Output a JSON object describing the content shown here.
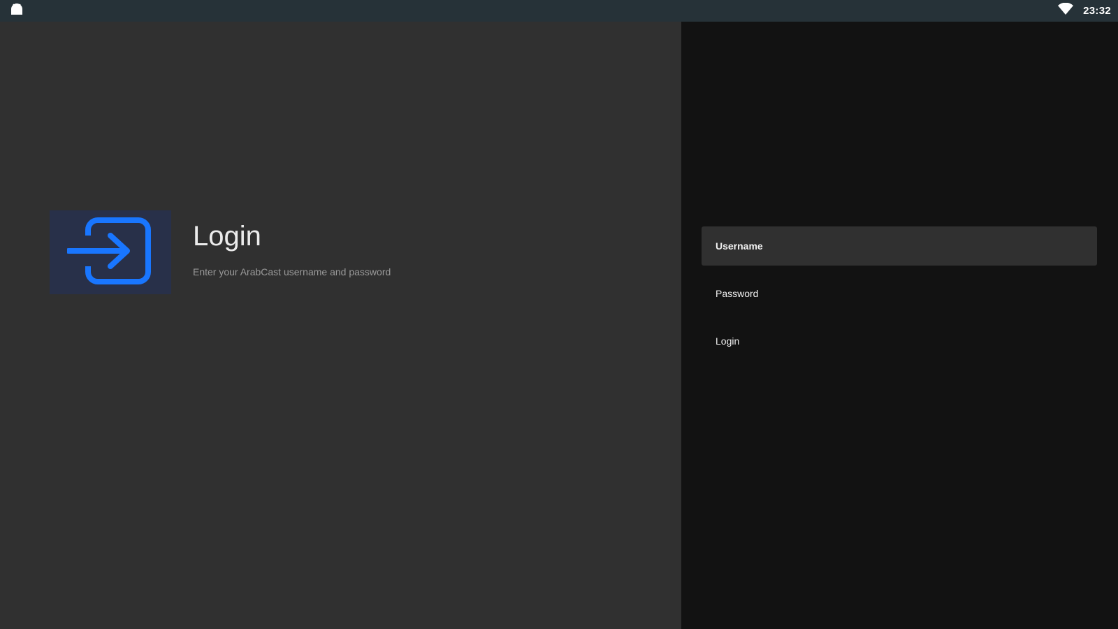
{
  "status_bar": {
    "time": "23:32",
    "left_icon": "android-icon",
    "wifi_icon": "wifi-icon"
  },
  "guidance": {
    "icon": "login-icon",
    "title": "Login",
    "description": "Enter your ArabCast username and password"
  },
  "actions": {
    "username": "Username",
    "password": "Password",
    "login": "Login"
  },
  "colors": {
    "accent": "#1976ff",
    "status_bar_bg": "#263238",
    "guidance_bg": "#303030",
    "actions_bg": "#121212",
    "icon_tile_bg": "#283049"
  }
}
